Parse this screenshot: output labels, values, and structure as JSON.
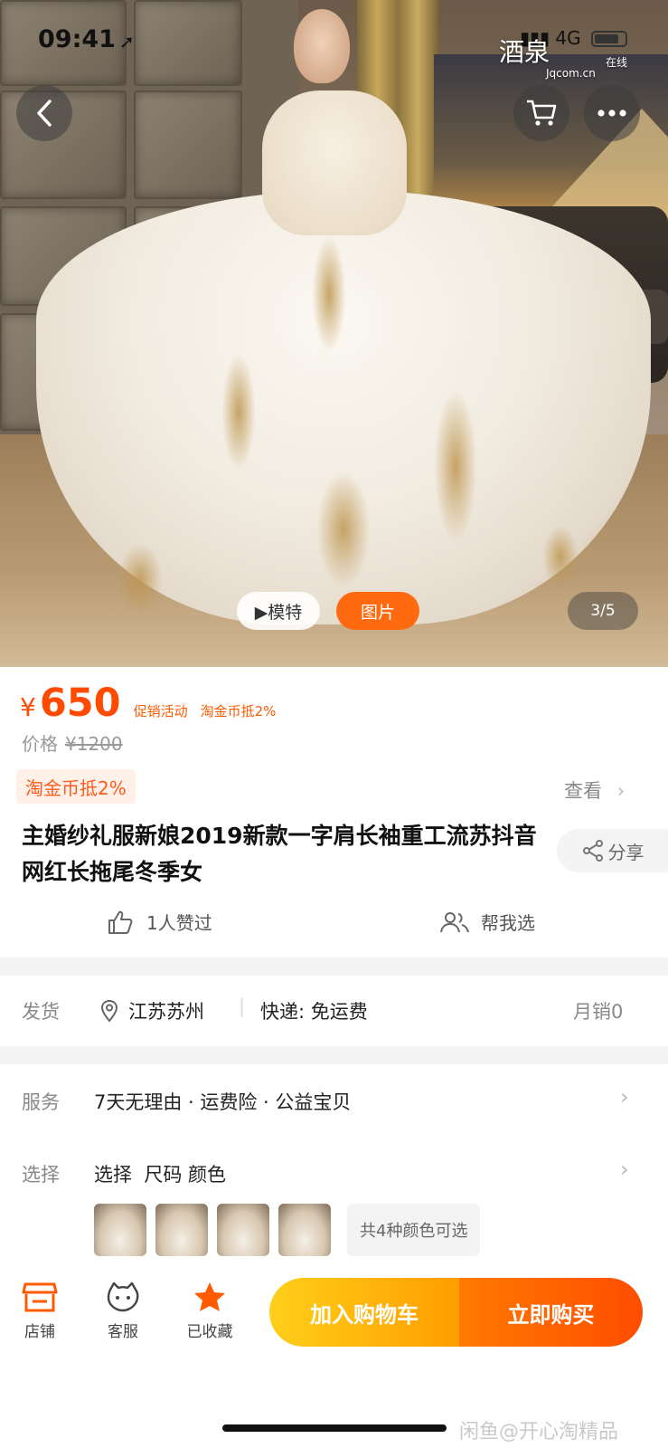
{
  "status_bar": {
    "time": "09:41",
    "signal": "4G"
  },
  "watermark": {
    "brand": "酒泉",
    "site": "Jqcom.cn",
    "online": "在线"
  },
  "gallery": {
    "model_label": "▶模特",
    "picture_label": "图片",
    "counter": "3/5"
  },
  "price": {
    "symbol": "¥",
    "value": "650",
    "promo": "促销活动",
    "coin_promo": "淘金币抵2%",
    "orig_label": "价格",
    "orig_value": "¥1200"
  },
  "coin_tag": "淘金币抵2%",
  "view_link": "查看",
  "product_title": "主婚纱礼服新娘2019新款一字肩长袖重工流苏抖音网红长拖尾冬季女",
  "share_label": "分享",
  "likes": "1人赞过",
  "help_choose": "帮我选",
  "shipping": {
    "label": "发货",
    "location": "江苏苏州",
    "express": "快递: 免运费",
    "monthly_sales": "月销0"
  },
  "service": {
    "label": "服务",
    "text": "7天无理由 · 运费险 · 公益宝贝"
  },
  "select": {
    "label": "选择",
    "text": "选择  尺码 颜色",
    "colors_available": "共4种颜色可选"
  },
  "bottom": {
    "store": "店铺",
    "service": "客服",
    "favorited": "已收藏",
    "add_to_cart": "加入购物车",
    "buy_now": "立即购买"
  },
  "credit": "闲鱼@开心淘精品",
  "colors": {
    "accent": "#ff4a00",
    "cart": "#ffb300",
    "buy": "#ff5a00"
  }
}
